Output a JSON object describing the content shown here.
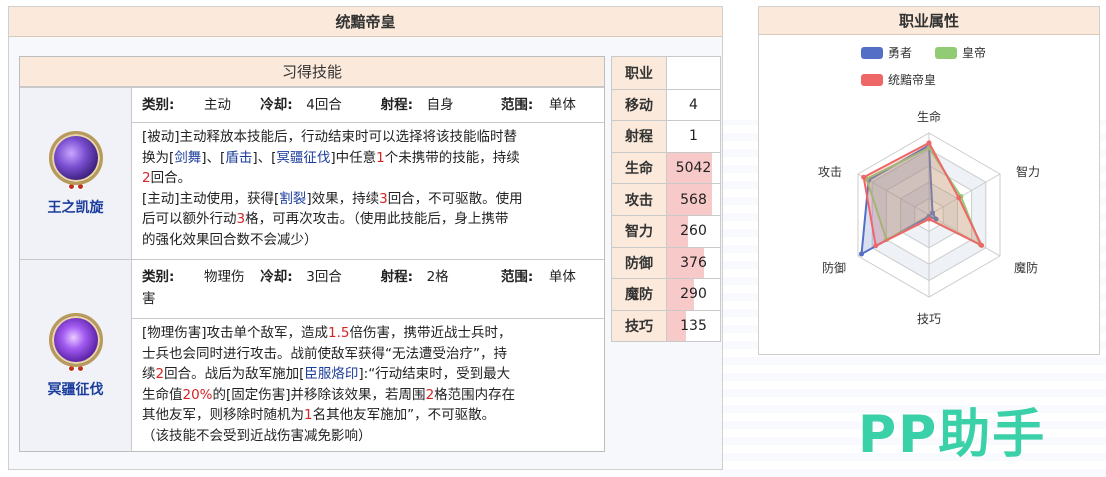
{
  "title": "统黯帝皇",
  "skills_header": "习得技能",
  "skills": [
    {
      "name": "王之凯旋",
      "meta": {
        "type_key": "类别:",
        "type_val": "主动",
        "cd_key": "冷却:",
        "cd_val": "4回合",
        "range_key": "射程:",
        "range_val": "自身",
        "area_key": "范围:",
        "area_val": "单体"
      },
      "desc": [
        [
          "[被动]主动释放本技能后，行动结束时可以选择将该技能临时替"
        ],
        [
          "换为[",
          "|剑舞",
          "]、[",
          "|盾击",
          "]、[",
          "|冥疆征伐",
          "]中任意",
          "!1",
          "个未携带的技能，持续"
        ],
        [
          "!2",
          "回合。"
        ],
        [
          "[主动]主动使用，获得[",
          "|割裂",
          "]效果，持续",
          "!3",
          "回合，不可驱散。使用"
        ],
        [
          "后可以额外行动",
          "!3",
          "格，可再次攻击。（使用此技能后，身上携带"
        ],
        [
          "的强化效果回合数不会减少）"
        ]
      ]
    },
    {
      "name": "冥疆征伐",
      "meta": {
        "type_key": "类别:",
        "type_val": "物理伤",
        "cd_key": "冷却:",
        "cd_val": "3回合",
        "range_key": "射程:",
        "range_val": "2格",
        "area_key": "范围:",
        "area_val": "单体",
        "area_tail": "害"
      },
      "desc": [
        [
          "[物理伤害]攻击单个敌军，造成",
          "!1.5",
          "倍伤害，携带近战士兵时，"
        ],
        [
          "士兵也会同时进行攻击。战前使敌军获得“无法遭受治疗”，持"
        ],
        [
          "续",
          "!2",
          "回合。战后为敌军施加[",
          "|臣服烙印",
          "]:“行动结束时，受到最大"
        ],
        [
          "生命值",
          "!20%",
          "的[固定伤害]并移除该效果，若周围",
          "!2",
          "格范围内存在"
        ],
        [
          "其他友军，则移除时随机为",
          "!1",
          "名其他友军施加”，不可驱散。"
        ],
        [
          "（该技能不会受到近战伤害减免影响）"
        ]
      ]
    }
  ],
  "stats": [
    {
      "key": "职业",
      "val": "",
      "pct": 0
    },
    {
      "key": "移动",
      "val": "4",
      "pct": 0
    },
    {
      "key": "射程",
      "val": "1",
      "pct": 0
    },
    {
      "key": "生命",
      "val": "5042",
      "pct": 0.85
    },
    {
      "key": "攻击",
      "val": "568",
      "pct": 0.85
    },
    {
      "key": "智力",
      "val": "260",
      "pct": 0.4
    },
    {
      "key": "防御",
      "val": "376",
      "pct": 0.7
    },
    {
      "key": "魔防",
      "val": "290",
      "pct": 0.5
    },
    {
      "key": "技巧",
      "val": "135",
      "pct": 0.35
    }
  ],
  "radar_title": "职业属性",
  "chart_data": {
    "type": "radar",
    "axes": [
      "生命",
      "智力",
      "魔防",
      "技巧",
      "防御",
      "攻击"
    ],
    "max": 1,
    "series": [
      {
        "name": "勇者",
        "color": "#5470c6",
        "values": [
          0.85,
          0.05,
          0.1,
          0.02,
          0.95,
          0.85
        ]
      },
      {
        "name": "皇帝",
        "color": "#91cc75",
        "values": [
          0.82,
          0.45,
          0.72,
          0.05,
          0.6,
          0.88
        ]
      },
      {
        "name": "统黯帝皇",
        "color": "#ee6666",
        "values": [
          0.88,
          0.42,
          0.74,
          0.05,
          0.75,
          0.92
        ]
      }
    ]
  },
  "colors": {
    "header_bg": "#fbeadb",
    "link": "#1b3d9c",
    "highlight": "#d42525",
    "bar": "#f8c9c9"
  },
  "watermark": "PP助手"
}
